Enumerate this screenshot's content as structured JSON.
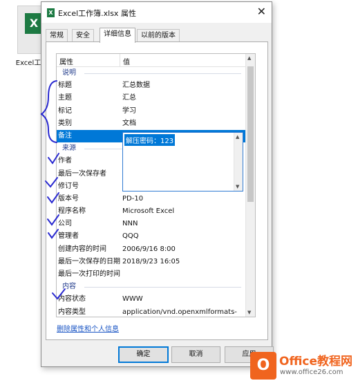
{
  "desktop": {
    "icon_label": "Excel工作",
    "icon_glyph": "X"
  },
  "window": {
    "title": "Excel工作簿.xlsx 属性",
    "close_glyph": "✕",
    "app_icon_glyph": "X"
  },
  "tabs": [
    {
      "label": "常规"
    },
    {
      "label": "安全"
    },
    {
      "label": "详细信息",
      "active": true
    },
    {
      "label": "以前的版本"
    }
  ],
  "table": {
    "headers": {
      "property": "属性",
      "value": "值"
    },
    "rows": [
      {
        "type": "group",
        "key": "说明"
      },
      {
        "key": "标题",
        "value": "汇总数据"
      },
      {
        "key": "主题",
        "value": "汇总"
      },
      {
        "key": "标记",
        "value": "学习"
      },
      {
        "key": "类别",
        "value": "文档"
      },
      {
        "key": "备注",
        "value": "解压密码：123",
        "selected": true
      },
      {
        "type": "group",
        "key": "来源"
      },
      {
        "key": "作者",
        "value": ""
      },
      {
        "key": "最后一次保存者",
        "value": ""
      },
      {
        "key": "修订号",
        "value": ""
      },
      {
        "key": "版本号",
        "value": "PD-10"
      },
      {
        "key": "程序名称",
        "value": "Microsoft Excel"
      },
      {
        "key": "公司",
        "value": "NNN"
      },
      {
        "key": "管理者",
        "value": "QQQ"
      },
      {
        "key": "创建内容的时间",
        "value": "2006/9/16 8:00"
      },
      {
        "key": "最后一次保存的日期",
        "value": "2018/9/23 16:05"
      },
      {
        "key": "最后一次打印的时间",
        "value": ""
      },
      {
        "type": "group",
        "key": "内容"
      },
      {
        "key": "内容状态",
        "value": "WWW"
      },
      {
        "key": "内容类型",
        "value": "application/vnd.openxmlformats-"
      }
    ],
    "edit_value": "解压密码：123"
  },
  "remove_link": "删除属性和个人信息",
  "buttons": {
    "ok": "确定",
    "cancel": "取消",
    "apply": "应用"
  },
  "watermark": {
    "logo": "O",
    "line1": "Office教程网",
    "line2": "www.office26.com"
  },
  "colors": {
    "selection": "#0078d7",
    "group_header": "#1f3a8a",
    "link": "#1a55c4",
    "ink_marks": "#2a2ad0",
    "watermark": "#f0641e"
  }
}
